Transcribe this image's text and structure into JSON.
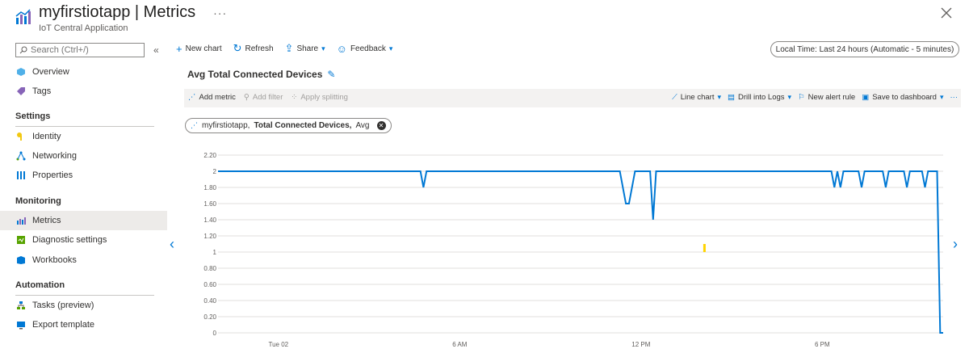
{
  "header": {
    "title": "myfirstiotapp | Metrics",
    "more": "···",
    "subtitle": "IoT Central Application"
  },
  "sidebar": {
    "search_placeholder": "Search (Ctrl+/)",
    "collapse": "«",
    "items": [
      {
        "label": "Overview",
        "icon": "overview-icon"
      },
      {
        "label": "Tags",
        "icon": "tag-icon"
      }
    ],
    "sections": [
      {
        "title": "Settings",
        "items": [
          {
            "label": "Identity",
            "icon": "key-icon"
          },
          {
            "label": "Networking",
            "icon": "network-icon"
          },
          {
            "label": "Properties",
            "icon": "properties-icon"
          }
        ]
      },
      {
        "title": "Monitoring",
        "items": [
          {
            "label": "Metrics",
            "icon": "metrics-icon",
            "active": true
          },
          {
            "label": "Diagnostic settings",
            "icon": "diagnostic-icon"
          },
          {
            "label": "Workbooks",
            "icon": "workbook-icon"
          }
        ]
      },
      {
        "title": "Automation",
        "items": [
          {
            "label": "Tasks (preview)",
            "icon": "tasks-icon"
          },
          {
            "label": "Export template",
            "icon": "export-icon"
          }
        ]
      }
    ]
  },
  "commandbar": {
    "new_chart": "New chart",
    "refresh": "Refresh",
    "share": "Share",
    "feedback": "Feedback",
    "time_range": "Local Time: Last 24 hours (Automatic - 5 minutes)"
  },
  "chart_panel": {
    "title": "Avg Total Connected Devices",
    "add_metric": "Add metric",
    "add_filter": "Add filter",
    "apply_splitting": "Apply splitting",
    "line_chart": "Line chart",
    "drill_logs": "Drill into Logs",
    "new_alert": "New alert rule",
    "save_dashboard": "Save to dashboard",
    "more": "···",
    "metric_resource": "myfirstiotapp,",
    "metric_name": "Total Connected Devices,",
    "metric_agg": "Avg"
  },
  "colors": {
    "accent": "#0078d4",
    "line": "#0078d4",
    "marker": "#ffd400"
  },
  "chart_data": {
    "type": "line",
    "title": "",
    "xlabel": "",
    "ylabel": "",
    "ylim": [
      0,
      2.2
    ],
    "yticks": [
      "2.20",
      "2",
      "1.80",
      "1.60",
      "1.40",
      "1.20",
      "1",
      "0.80",
      "0.60",
      "0.40",
      "0.20",
      "0"
    ],
    "ytick_values": [
      2.2,
      2,
      1.8,
      1.6,
      1.4,
      1.2,
      1,
      0.8,
      0.6,
      0.4,
      0.2,
      0
    ],
    "xlim": [
      0,
      24
    ],
    "xticks": [
      {
        "label": "Tue 02",
        "value": 2
      },
      {
        "label": "6 AM",
        "value": 8
      },
      {
        "label": "12 PM",
        "value": 14
      },
      {
        "label": "6 PM",
        "value": 20
      }
    ],
    "series": [
      {
        "x": [
          0,
          6.7,
          6.8,
          6.9,
          13.3,
          13.5,
          13.6,
          13.8,
          14.3,
          14.4,
          14.5,
          20.3,
          20.4,
          20.5,
          20.6,
          20.7,
          21.2,
          21.3,
          21.4,
          22.0,
          22.1,
          22.2,
          22.7,
          22.8,
          22.9,
          23.3,
          23.4,
          23.5,
          23.8,
          23.9,
          24.0
        ],
        "y": [
          2,
          2,
          1.8,
          2,
          2,
          1.6,
          1.6,
          2,
          2,
          1.4,
          2,
          2,
          1.8,
          2,
          1.8,
          2,
          2,
          1.8,
          2,
          2,
          1.8,
          2,
          2,
          1.8,
          2,
          2,
          1.8,
          2,
          2,
          0,
          0
        ]
      }
    ],
    "marker": {
      "x": 16.1,
      "y": 1.05
    },
    "grid": true,
    "legend": "none"
  }
}
